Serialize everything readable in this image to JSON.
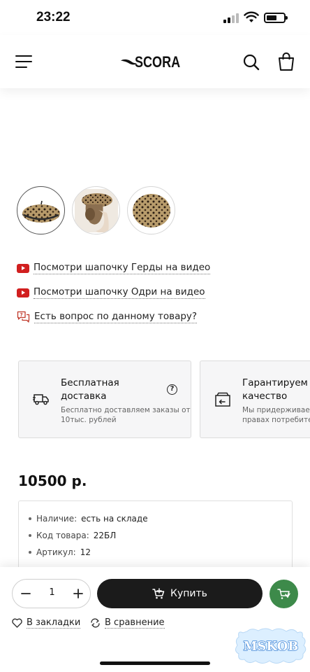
{
  "status_bar": {
    "time": "23:22"
  },
  "header": {
    "logo_text": "SCORA"
  },
  "thumbnails": [
    {
      "name": "beret-front"
    },
    {
      "name": "beret-model"
    },
    {
      "name": "beret-top"
    }
  ],
  "links": {
    "video_gerda": "Посмотри шапочку Герды на видео",
    "video_odri": "Посмотри шапочку Одри на видео",
    "question": "Есть вопрос по данному товару?"
  },
  "cards": {
    "delivery": {
      "title_line1": "Бесплатная",
      "title_line2": "доставка",
      "desc_line1": "Бесплатно доставляем заказы от",
      "desc_line2": "10тыс. рублей"
    },
    "guarantee": {
      "title_line1": "Гарантируем",
      "title_line2": "качество",
      "desc_line1": "Мы придерживаем",
      "desc_line2": "правах потребителе"
    }
  },
  "price": "10500 р.",
  "info": {
    "availability_label": "Наличие:",
    "availability_value": "есть на складе",
    "code_label": "Код товара:",
    "code_value": "22БЛ",
    "article_label": "Артикул:",
    "article_value": "12"
  },
  "actions": {
    "quantity": "1",
    "buy_label": "Купить",
    "bookmark_label": "В закладки",
    "compare_label": "В сравнение"
  },
  "watermark": {
    "text": "MSKOB"
  },
  "colors": {
    "youtube_red": "#d11f1f",
    "buy_button": "#1b1b1b",
    "fast_order_green": "#3d8a4a",
    "card_bg": "#f6f6f7"
  }
}
